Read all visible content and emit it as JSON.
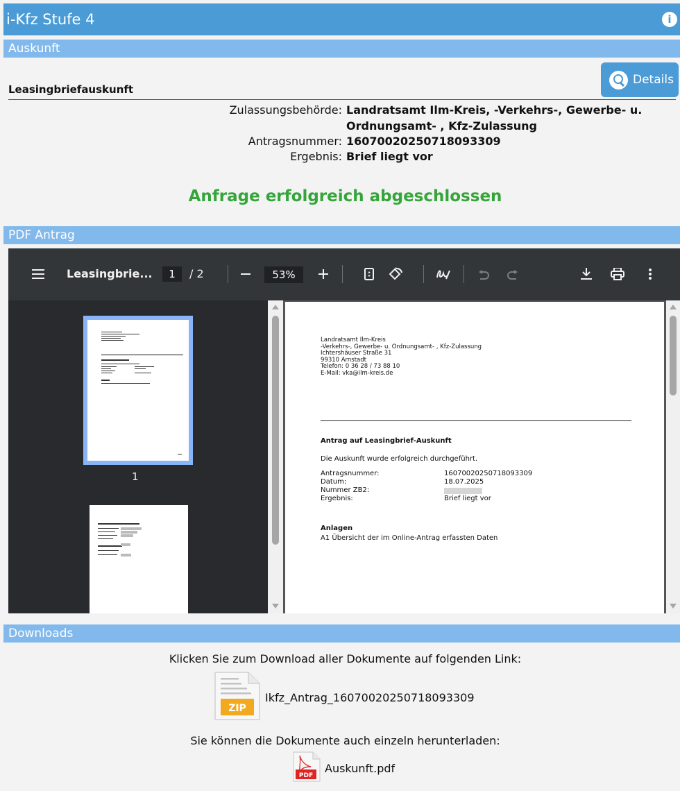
{
  "app": {
    "title": "i-Kfz Stufe 4",
    "info_icon": "info-icon"
  },
  "sections": {
    "auskunft": "Auskunft",
    "pdf_antrag": "PDF Antrag",
    "downloads": "Downloads"
  },
  "details_button": {
    "label": "Details",
    "icon": "search-icon"
  },
  "auskunft": {
    "heading": "Leasingbriefauskunft",
    "rows": [
      {
        "key": "Zulassungsbehörde:",
        "value_line1": "Landratsamt Ilm-Kreis, -Verkehrs-, Gewerbe- u.",
        "value_line2": "Ordnungsamt- , Kfz-Zulassung"
      },
      {
        "key": "Antragsnummer:",
        "value": "16070020250718093309"
      },
      {
        "key": "Ergebnis:",
        "value": "Brief liegt vor"
      }
    ],
    "status": "Anfrage erfolgreich abgeschlossen",
    "status_color": "#35a53a"
  },
  "pdf_viewer": {
    "filename": "Leasingbrie...",
    "current_page": "1",
    "page_total": "/ 2",
    "zoom": "53%",
    "thumbnail_label": "1",
    "document": {
      "address": "Landratsamt Ilm-Kreis\n-Verkehrs-, Gewerbe- u. Ordnungsamt- , Kfz-Zulassung\nIchtershäuser Straße 31\n99310 Arnstadt\nTelefon: 0 36 28 / 73 88 10\nE-Mail: vka@ilm-kreis.de",
      "heading": "Antrag auf Leasingbrief-Auskunft",
      "intro": "Die Auskunft wurde erfolgreich durchgeführt.",
      "fields": [
        {
          "label": "Antragsnummer:",
          "value": "16070020250718093309"
        },
        {
          "label": "Datum:",
          "value": "18.07.2025"
        },
        {
          "label": "Nummer ZB2:",
          "value": ""
        },
        {
          "label": "Ergebnis:",
          "value": "Brief liegt vor"
        }
      ],
      "attachments_heading": "Anlagen",
      "attachment": "A1 Übersicht der im Online-Antrag erfassten Daten"
    }
  },
  "downloads": {
    "all_text": "Klicken Sie zum Download aller Dokumente auf folgenden Link:",
    "zip_name": "Ikfz_Antrag_16070020250718093309",
    "zip_badge": "ZIP",
    "single_text": "Sie können die Dokumente auch einzeln herunterladen:",
    "pdf_name": "Auskunft.pdf",
    "pdf_badge": "PDF"
  }
}
